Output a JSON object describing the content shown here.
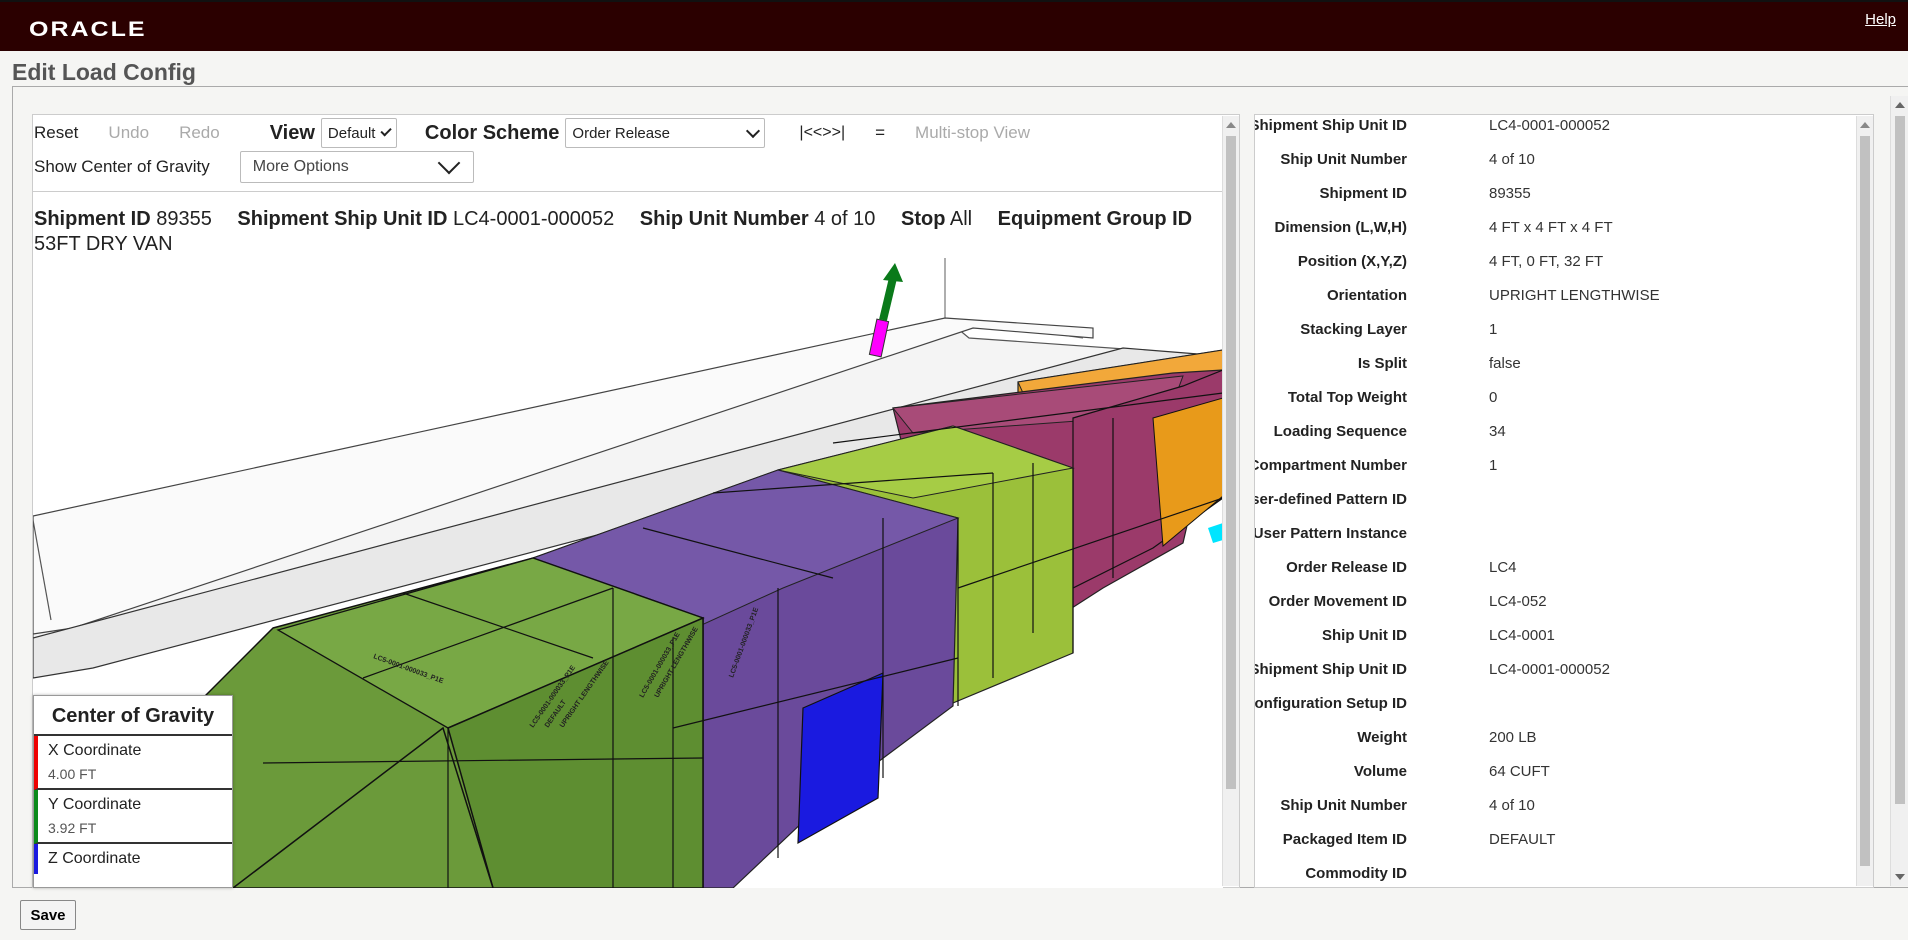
{
  "app": {
    "logo": "ORACLE",
    "help_label": "Help"
  },
  "page": {
    "title": "Edit Load Config",
    "save_label": "Save"
  },
  "toolbar": {
    "reset": "Reset",
    "undo": "Undo",
    "redo": "Redo",
    "view_label": "View",
    "view_value": "Default",
    "color_scheme_label": "Color Scheme",
    "color_scheme_value": "Order Release",
    "nav_label": "|<<>>|",
    "equals_label": "=",
    "multistop_label": "Multi-stop View",
    "show_cog_label": "Show Center of Gravity",
    "more_options_label": "More Options"
  },
  "header": {
    "shipment_id_label": "Shipment ID",
    "shipment_id_value": "89355",
    "ssu_label": "Shipment Ship Unit ID",
    "ssu_value": "LC4-0001-000052",
    "unit_number_label": "Ship Unit Number",
    "unit_number_value": "4 of 10",
    "stop_label": "Stop",
    "stop_value": "All",
    "equipment_label": "Equipment Group ID",
    "equipment_value": "53FT DRY VAN"
  },
  "cog": {
    "title": "Center of Gravity",
    "x_label": "X Coordinate",
    "x_value": "4.00 FT",
    "y_label": "Y Coordinate",
    "y_value": "3.92 FT",
    "z_label": "Z Coordinate"
  },
  "box_label": "LC5-0001-000033_P1E\nC25\nDEFAULT\nUPRIGHT LENGTHWISE",
  "colors": {
    "green": "#6b9a3a",
    "lime": "#9bc03a",
    "purple": "#6a4a9b",
    "magenta": "#9b3a6a",
    "orange": "#e89a1a",
    "blue": "#1a1ae0",
    "topbar": "#2b0000"
  },
  "details": [
    {
      "label": "Shipment Ship Unit ID",
      "value": "LC4-0001-000052"
    },
    {
      "label": "Ship Unit Number",
      "value": "4 of 10"
    },
    {
      "label": "Shipment ID",
      "value": "89355"
    },
    {
      "label": "Dimension (L,W,H)",
      "value": "4 FT x 4 FT x 4 FT"
    },
    {
      "label": "Position (X,Y,Z)",
      "value": "4 FT, 0 FT, 32 FT"
    },
    {
      "label": "Orientation",
      "value": "UPRIGHT LENGTHWISE"
    },
    {
      "label": "Stacking Layer",
      "value": "1"
    },
    {
      "label": "Is Split",
      "value": "false"
    },
    {
      "label": "Total Top Weight",
      "value": "0"
    },
    {
      "label": "Loading Sequence",
      "value": "34"
    },
    {
      "label": "Compartment Number",
      "value": "1"
    },
    {
      "label": "User-defined Pattern ID",
      "value": ""
    },
    {
      "label": "User Pattern Instance",
      "value": ""
    },
    {
      "label": "Order Release ID",
      "value": "LC4"
    },
    {
      "label": "Order Movement ID",
      "value": "LC4-052"
    },
    {
      "label": "Ship Unit ID",
      "value": "LC4-0001"
    },
    {
      "label": "Shipment Ship Unit ID",
      "value": "LC4-0001-000052"
    },
    {
      "label": "Load Configuration Setup ID",
      "value": ""
    },
    {
      "label": "Weight",
      "value": "200 LB"
    },
    {
      "label": "Volume",
      "value": "64 CUFT"
    },
    {
      "label": "Ship Unit Number",
      "value": "4 of 10"
    },
    {
      "label": "Packaged Item ID",
      "value": "DEFAULT"
    },
    {
      "label": "Commodity ID",
      "value": ""
    }
  ]
}
